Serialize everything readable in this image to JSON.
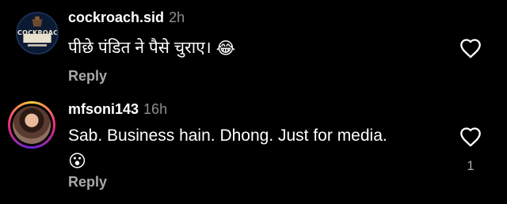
{
  "comments": [
    {
      "username": "cockroach.sid",
      "time": "2h",
      "text": "पीछे पंडित ने पैसे चुराए।",
      "emoji": "😂",
      "reply_label": "Reply",
      "avatar_logo_text": "COCKROACH",
      "like_icon": "heart-outline-icon"
    },
    {
      "username": "mfsoni143",
      "time": "16h",
      "text": "Sab.  Business hain. Dhong. Just for media.",
      "emoji": "😮",
      "reply_label": "Reply",
      "like_count": "1",
      "like_icon": "heart-outline-icon"
    }
  ],
  "colors": {
    "background": "#000000",
    "primary_text": "#ffffff",
    "secondary_text": "#8e8e8e",
    "reply_text": "#a8a8a8"
  }
}
